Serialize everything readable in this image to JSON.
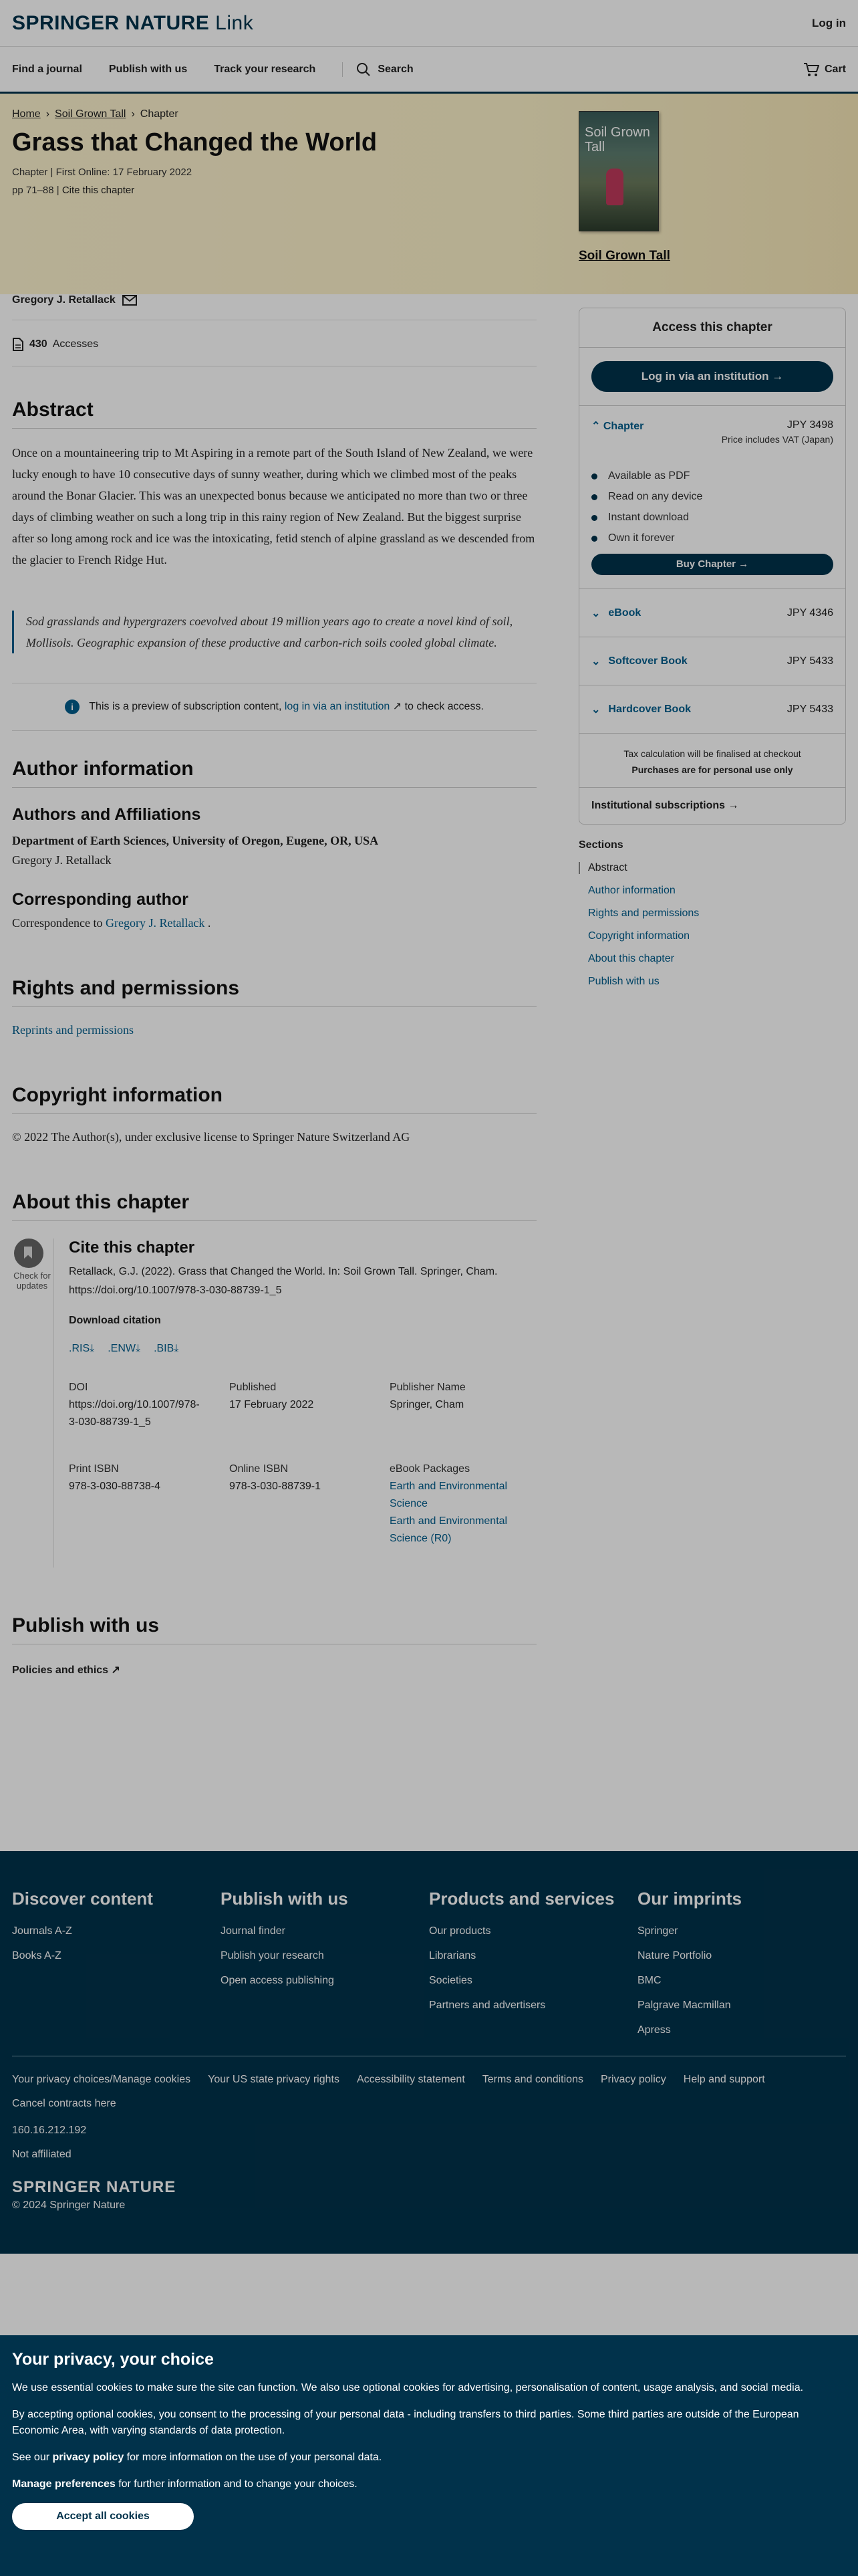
{
  "header": {
    "brand": "SPRINGER NATURE",
    "brand_suffix": "Link",
    "login": "Log in",
    "nav": [
      "Find a journal",
      "Publish with us",
      "Track your research"
    ],
    "search": "Search",
    "cart": "Cart"
  },
  "hero": {
    "breadcrumb": [
      "Home",
      "Soil Grown Tall",
      "Chapter"
    ],
    "title": "Grass that Changed the World",
    "chapter_label": "Chapter",
    "first_online": "First Online: 17 February 2022",
    "pages": "pp 71–88",
    "cite_link": "Cite this chapter",
    "book_cover_title": "Soil Grown Tall",
    "book_link": "Soil Grown Tall"
  },
  "author": {
    "name": "Gregory J. Retallack",
    "accesses_count": "430",
    "accesses_label": "Accesses"
  },
  "abstract": {
    "heading": "Abstract",
    "text": "Once on a mountaineering trip to Mt Aspiring in a remote part of the South Island of New Zealand, we were lucky enough to have 10 consecutive days of sunny weather, during which we climbed most of the peaks around the Bonar Glacier. This was an unexpected bonus because we anticipated no more than two or three days of climbing weather on such a long trip in this rainy region of New Zealand. But the biggest surprise after so long among rock and ice was the intoxicating, fetid stench of alpine grassland as we descended from the glacier to French Ridge Hut.",
    "quote": "Sod grasslands and hypergrazers coevolved about 19 million years ago to create a novel kind of soil, Mollisols. Geographic expansion of these productive and carbon-rich soils cooled global climate.",
    "preview_before": "This is a preview of subscription content,",
    "preview_link": "log in via an institution",
    "preview_after": "to check access."
  },
  "author_info": {
    "heading": "Author information",
    "affil_heading": "Authors and Affiliations",
    "department": "Department of Earth Sciences, University of Oregon, Eugene, OR, USA",
    "author": "Gregory J. Retallack",
    "corr_heading": "Corresponding author",
    "corr_prefix": "Correspondence to",
    "corr_name": "Gregory J. Retallack",
    "corr_suffix": "."
  },
  "rights": {
    "heading": "Rights and permissions",
    "link": "Reprints and permissions"
  },
  "copyright": {
    "heading": "Copyright information",
    "text": "© 2022 The Author(s), under exclusive license to Springer Nature Switzerland AG"
  },
  "about": {
    "heading": "About this chapter",
    "check_label": "Check for updates",
    "cite_heading": "Cite this chapter",
    "citation": "Retallack, G.J. (2022). Grass that Changed the World. In: Soil Grown Tall. Springer, Cham. https://doi.org/10.1007/978-3-030-88739-1_5",
    "download_label": "Download citation",
    "formats": [
      ".RIS",
      ".ENW",
      ".BIB"
    ],
    "doi_label": "DOI",
    "doi_value": "https://doi.org/10.1007/978-3-030-88739-1_5",
    "published_label": "Published",
    "published_value": "17 February 2022",
    "publisher_label": "Publisher Name",
    "publisher_value": "Springer, Cham",
    "print_isbn_label": "Print ISBN",
    "print_isbn_value": "978-3-030-88738-4",
    "online_isbn_label": "Online ISBN",
    "online_isbn_value": "978-3-030-88739-1",
    "packages_label": "eBook Packages",
    "packages": [
      "Earth and Environmental Science",
      "Earth and Environmental Science (R0)"
    ]
  },
  "publish": {
    "heading": "Publish with us",
    "policies": "Policies and ethics"
  },
  "sidebar": {
    "access_heading": "Access this chapter",
    "institution_btn": "Log in via an institution",
    "chapter_label": "Chapter",
    "chapter_price": "JPY 3498",
    "vat": "Price includes VAT (Japan)",
    "features": [
      "Available as PDF",
      "Read on any device",
      "Instant download",
      "Own it forever"
    ],
    "buy_btn": "Buy Chapter",
    "options": [
      {
        "name": "eBook",
        "price": "JPY 4346"
      },
      {
        "name": "Softcover Book",
        "price": "JPY 5433"
      },
      {
        "name": "Hardcover Book",
        "price": "JPY 5433"
      }
    ],
    "tax_note": "Tax calculation will be finalised at checkout",
    "personal_use": "Purchases are for personal use only",
    "institutional": "Institutional subscriptions",
    "sections_label": "Sections",
    "sections": [
      "Abstract",
      "Author information",
      "Rights and permissions",
      "Copyright information",
      "About this chapter",
      "Publish with us"
    ]
  },
  "footer": {
    "columns": [
      {
        "title": "Discover content",
        "links": [
          "Journals A-Z",
          "Books A-Z"
        ]
      },
      {
        "title": "Publish with us",
        "links": [
          "Journal finder",
          "Publish your research",
          "Open access publishing"
        ]
      },
      {
        "title": "Products and services",
        "links": [
          "Our products",
          "Librarians",
          "Societies",
          "Partners and advertisers"
        ]
      },
      {
        "title": "Our imprints",
        "links": [
          "Springer",
          "Nature Portfolio",
          "BMC",
          "Palgrave Macmillan",
          "Apress"
        ]
      }
    ],
    "legal_links": [
      "Your privacy choices/Manage cookies",
      "Your US state privacy rights",
      "Accessibility statement",
      "Terms and conditions",
      "Privacy policy",
      "Help and support",
      "Cancel contracts here"
    ],
    "ip": "160.16.212.192",
    "affiliation": "Not affiliated",
    "brand": "SPRINGER NATURE",
    "copyright": "© 2024 Springer Nature"
  },
  "consent": {
    "title": "Your privacy, your choice",
    "p1": "We use essential cookies to make sure the site can function. We also use optional cookies for advertising, personalisation of content, usage analysis, and social media.",
    "p2": "By accepting optional cookies, you consent to the processing of your personal data - including transfers to third parties. Some third parties are outside of the European Economic Area, with varying standards of data protection.",
    "p3_prefix": "See our",
    "p3_link": "privacy policy",
    "p3_suffix": "for more information on the use of your personal data.",
    "p4_link": "Manage preferences",
    "p4_suffix": "for further information and to change your choices.",
    "accept": "Accept all cookies"
  }
}
